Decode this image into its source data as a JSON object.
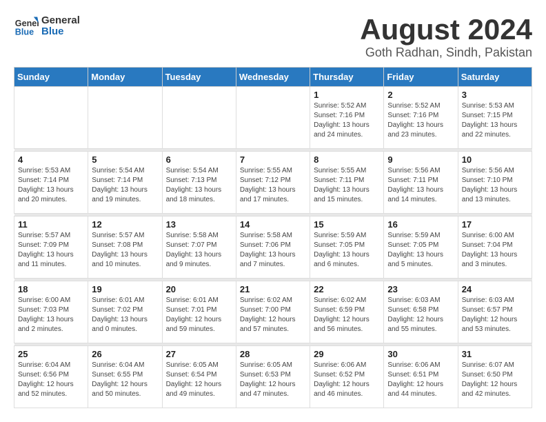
{
  "logo": {
    "text_general": "General",
    "text_blue": "Blue"
  },
  "title": "August 2024",
  "location": "Goth Radhan, Sindh, Pakistan",
  "days_of_week": [
    "Sunday",
    "Monday",
    "Tuesday",
    "Wednesday",
    "Thursday",
    "Friday",
    "Saturday"
  ],
  "weeks": [
    [
      {
        "day": "",
        "info": ""
      },
      {
        "day": "",
        "info": ""
      },
      {
        "day": "",
        "info": ""
      },
      {
        "day": "",
        "info": ""
      },
      {
        "day": "1",
        "sunrise": "5:52 AM",
        "sunset": "7:16 PM",
        "daylight": "13 hours and 24 minutes."
      },
      {
        "day": "2",
        "sunrise": "5:52 AM",
        "sunset": "7:16 PM",
        "daylight": "13 hours and 23 minutes."
      },
      {
        "day": "3",
        "sunrise": "5:53 AM",
        "sunset": "7:15 PM",
        "daylight": "13 hours and 22 minutes."
      }
    ],
    [
      {
        "day": "4",
        "sunrise": "5:53 AM",
        "sunset": "7:14 PM",
        "daylight": "13 hours and 20 minutes."
      },
      {
        "day": "5",
        "sunrise": "5:54 AM",
        "sunset": "7:14 PM",
        "daylight": "13 hours and 19 minutes."
      },
      {
        "day": "6",
        "sunrise": "5:54 AM",
        "sunset": "7:13 PM",
        "daylight": "13 hours and 18 minutes."
      },
      {
        "day": "7",
        "sunrise": "5:55 AM",
        "sunset": "7:12 PM",
        "daylight": "13 hours and 17 minutes."
      },
      {
        "day": "8",
        "sunrise": "5:55 AM",
        "sunset": "7:11 PM",
        "daylight": "13 hours and 15 minutes."
      },
      {
        "day": "9",
        "sunrise": "5:56 AM",
        "sunset": "7:11 PM",
        "daylight": "13 hours and 14 minutes."
      },
      {
        "day": "10",
        "sunrise": "5:56 AM",
        "sunset": "7:10 PM",
        "daylight": "13 hours and 13 minutes."
      }
    ],
    [
      {
        "day": "11",
        "sunrise": "5:57 AM",
        "sunset": "7:09 PM",
        "daylight": "13 hours and 11 minutes."
      },
      {
        "day": "12",
        "sunrise": "5:57 AM",
        "sunset": "7:08 PM",
        "daylight": "13 hours and 10 minutes."
      },
      {
        "day": "13",
        "sunrise": "5:58 AM",
        "sunset": "7:07 PM",
        "daylight": "13 hours and 9 minutes."
      },
      {
        "day": "14",
        "sunrise": "5:58 AM",
        "sunset": "7:06 PM",
        "daylight": "13 hours and 7 minutes."
      },
      {
        "day": "15",
        "sunrise": "5:59 AM",
        "sunset": "7:05 PM",
        "daylight": "13 hours and 6 minutes."
      },
      {
        "day": "16",
        "sunrise": "5:59 AM",
        "sunset": "7:05 PM",
        "daylight": "13 hours and 5 minutes."
      },
      {
        "day": "17",
        "sunrise": "6:00 AM",
        "sunset": "7:04 PM",
        "daylight": "13 hours and 3 minutes."
      }
    ],
    [
      {
        "day": "18",
        "sunrise": "6:00 AM",
        "sunset": "7:03 PM",
        "daylight": "13 hours and 2 minutes."
      },
      {
        "day": "19",
        "sunrise": "6:01 AM",
        "sunset": "7:02 PM",
        "daylight": "13 hours and 0 minutes."
      },
      {
        "day": "20",
        "sunrise": "6:01 AM",
        "sunset": "7:01 PM",
        "daylight": "12 hours and 59 minutes."
      },
      {
        "day": "21",
        "sunrise": "6:02 AM",
        "sunset": "7:00 PM",
        "daylight": "12 hours and 57 minutes."
      },
      {
        "day": "22",
        "sunrise": "6:02 AM",
        "sunset": "6:59 PM",
        "daylight": "12 hours and 56 minutes."
      },
      {
        "day": "23",
        "sunrise": "6:03 AM",
        "sunset": "6:58 PM",
        "daylight": "12 hours and 55 minutes."
      },
      {
        "day": "24",
        "sunrise": "6:03 AM",
        "sunset": "6:57 PM",
        "daylight": "12 hours and 53 minutes."
      }
    ],
    [
      {
        "day": "25",
        "sunrise": "6:04 AM",
        "sunset": "6:56 PM",
        "daylight": "12 hours and 52 minutes."
      },
      {
        "day": "26",
        "sunrise": "6:04 AM",
        "sunset": "6:55 PM",
        "daylight": "12 hours and 50 minutes."
      },
      {
        "day": "27",
        "sunrise": "6:05 AM",
        "sunset": "6:54 PM",
        "daylight": "12 hours and 49 minutes."
      },
      {
        "day": "28",
        "sunrise": "6:05 AM",
        "sunset": "6:53 PM",
        "daylight": "12 hours and 47 minutes."
      },
      {
        "day": "29",
        "sunrise": "6:06 AM",
        "sunset": "6:52 PM",
        "daylight": "12 hours and 46 minutes."
      },
      {
        "day": "30",
        "sunrise": "6:06 AM",
        "sunset": "6:51 PM",
        "daylight": "12 hours and 44 minutes."
      },
      {
        "day": "31",
        "sunrise": "6:07 AM",
        "sunset": "6:50 PM",
        "daylight": "12 hours and 42 minutes."
      }
    ]
  ]
}
